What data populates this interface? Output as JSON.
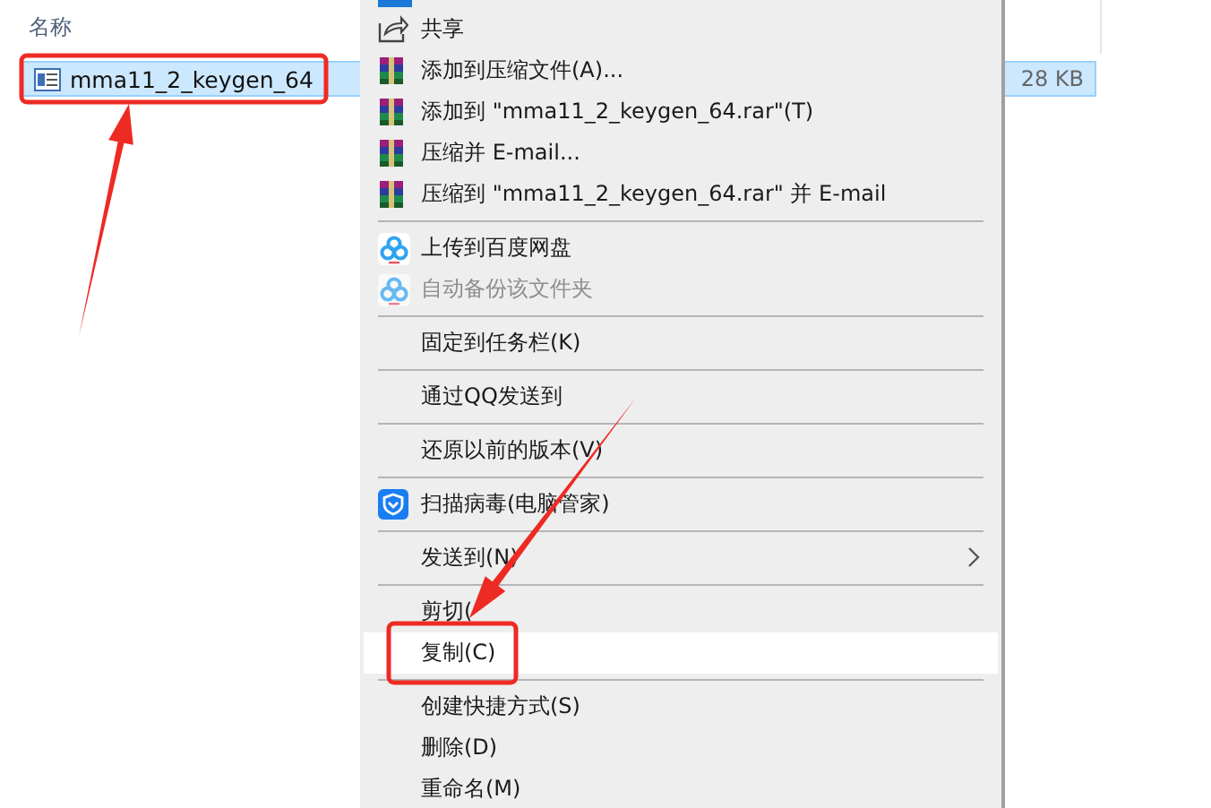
{
  "explorer": {
    "column_header": "名称",
    "file": {
      "name": "mma11_2_keygen_64",
      "size": "28 KB",
      "selected": true
    }
  },
  "context_menu": {
    "items": [
      {
        "kind": "share",
        "label": "共享",
        "disabled": false,
        "selected": false,
        "submenu": false
      },
      {
        "kind": "archive",
        "label": "添加到压缩文件(A)...",
        "disabled": false,
        "selected": false,
        "submenu": false
      },
      {
        "kind": "archive",
        "label": "添加到 \"mma11_2_keygen_64.rar\"(T)",
        "disabled": false,
        "selected": false,
        "submenu": false
      },
      {
        "kind": "archive",
        "label": "压缩并 E-mail...",
        "disabled": false,
        "selected": false,
        "submenu": false
      },
      {
        "kind": "archive",
        "label": "压缩到 \"mma11_2_keygen_64.rar\" 并 E-mail",
        "disabled": false,
        "selected": false,
        "submenu": false
      },
      {
        "kind": "separator"
      },
      {
        "kind": "cloud",
        "label": "上传到百度网盘",
        "disabled": false,
        "selected": false,
        "submenu": false
      },
      {
        "kind": "cloud",
        "label": "自动备份该文件夹",
        "disabled": true,
        "selected": false,
        "submenu": false
      },
      {
        "kind": "separator"
      },
      {
        "kind": "plain",
        "label": "固定到任务栏(K)",
        "disabled": false,
        "selected": false,
        "submenu": false
      },
      {
        "kind": "separator"
      },
      {
        "kind": "plain",
        "label": "通过QQ发送到",
        "disabled": false,
        "selected": false,
        "submenu": false
      },
      {
        "kind": "separator"
      },
      {
        "kind": "plain",
        "label": "还原以前的版本(V)",
        "disabled": false,
        "selected": false,
        "submenu": false
      },
      {
        "kind": "separator"
      },
      {
        "kind": "shield",
        "label": "扫描病毒(电脑管家)",
        "disabled": false,
        "selected": false,
        "submenu": false
      },
      {
        "kind": "separator"
      },
      {
        "kind": "plain",
        "label": "发送到(N)",
        "disabled": false,
        "selected": false,
        "submenu": true
      },
      {
        "kind": "separator"
      },
      {
        "kind": "plain",
        "label": "剪切(",
        "disabled": false,
        "selected": false,
        "submenu": false
      },
      {
        "kind": "plain",
        "label": "复制(C)",
        "disabled": false,
        "selected": true,
        "submenu": false
      },
      {
        "kind": "separator"
      },
      {
        "kind": "plain",
        "label": "创建快捷方式(S)",
        "disabled": false,
        "selected": false,
        "submenu": false
      },
      {
        "kind": "plain",
        "label": "删除(D)",
        "disabled": false,
        "selected": false,
        "submenu": false
      },
      {
        "kind": "plain",
        "label": "重命名(M)",
        "disabled": false,
        "selected": false,
        "submenu": false
      }
    ]
  }
}
